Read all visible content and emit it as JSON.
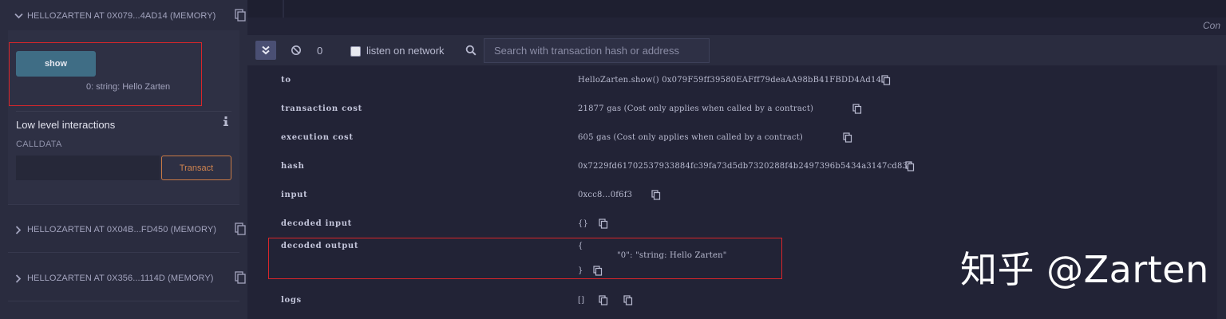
{
  "deploy": {
    "contracts": [
      {
        "name": "HELLOZARTEN AT 0X079...4AD14 (MEMORY)",
        "expanded": true
      },
      {
        "name": "HELLOZARTEN AT 0X04B...FD450 (MEMORY)",
        "expanded": false
      },
      {
        "name": "HELLOZARTEN AT 0X356...1114D (MEMORY)",
        "expanded": false
      }
    ],
    "show_label": "show",
    "show_result": "0: string: Hello Zarten",
    "low_level_title": "Low level interactions",
    "calldata_label": "CALLDATA",
    "calldata_value": "",
    "transact_label": "Transact"
  },
  "terminal": {
    "console_label": "Con",
    "pending_count": "0",
    "listen_label": "listen on network",
    "listen_checked": false,
    "search_placeholder": "Search with transaction hash or address",
    "rows": [
      {
        "key": "to",
        "value": "HelloZarten.show() 0x079F59ff39580EAFff79deaAA98bB41FBDD4Ad14"
      },
      {
        "key": "transaction cost",
        "value": "21877 gas (Cost only applies when called by a contract)"
      },
      {
        "key": "execution cost",
        "value": "605 gas (Cost only applies when called by a contract)"
      },
      {
        "key": "hash",
        "value": "0x7229fd61702537933884fc39fa73d5db7320288f4b2497396b5434a3147cd836"
      },
      {
        "key": "input",
        "value": "0xcc8...0f6f3"
      },
      {
        "key": "decoded input",
        "value": "{}"
      },
      {
        "key": "decoded output",
        "value_open": "{",
        "value_line": "\"0\": \"string: Hello Zarten\"",
        "value_close": "}"
      },
      {
        "key": "logs",
        "value": "[]"
      }
    ]
  },
  "watermark": "知乎 @Zarten",
  "colors": {
    "panel_bg": "#2a2c3f",
    "terminal_bg": "#222336",
    "primary_button": "#3f6d85",
    "transact_accent": "#d0844f",
    "highlight_red": "#d9262a"
  }
}
